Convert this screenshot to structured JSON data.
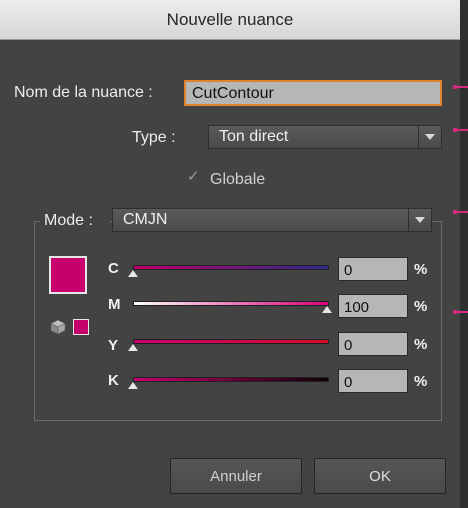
{
  "dialog": {
    "title": "Nouvelle nuance"
  },
  "name_row": {
    "label": "Nom de la nuance :",
    "value": "CutContour"
  },
  "type_row": {
    "label": "Type :",
    "value": "Ton direct"
  },
  "global_check": {
    "label": "Globale",
    "checked": true
  },
  "mode_row": {
    "label": "Mode :",
    "value": "CMJN"
  },
  "swatch": {
    "color": "#c8006e"
  },
  "channels": [
    {
      "letter": "C",
      "value": "0",
      "pct": "%",
      "fraction": 0.0,
      "gradient": [
        "#c0006a",
        "#2e2a8a"
      ]
    },
    {
      "letter": "M",
      "value": "100",
      "pct": "%",
      "fraction": 1.0,
      "gradient": [
        "#ffffff",
        "#d8007a"
      ]
    },
    {
      "letter": "Y",
      "value": "0",
      "pct": "%",
      "fraction": 0.0,
      "gradient": [
        "#c8006e",
        "#d60a2a"
      ]
    },
    {
      "letter": "K",
      "value": "0",
      "pct": "%",
      "fraction": 0.0,
      "gradient": [
        "#c8006e",
        "#100008"
      ]
    }
  ],
  "buttons": {
    "cancel": "Annuler",
    "ok": "OK"
  },
  "colors": {
    "accent_focus": "#e0822e",
    "marker": "#d62a7d"
  }
}
